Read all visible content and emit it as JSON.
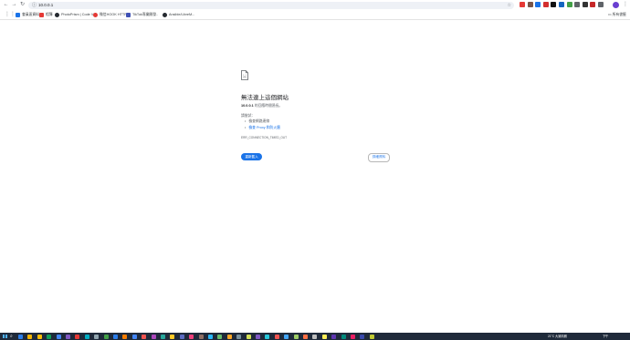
{
  "browser": {
    "url": "10.0.0.1",
    "bookmarks": [
      {
        "label": "會員區資料",
        "color": "#1a73e8"
      },
      {
        "label": "相簿",
        "color": "#e53935"
      },
      {
        "label": "PhotoPrism | Code V...",
        "color": "#24292f"
      },
      {
        "label": "微信HOOK HTTP",
        "color": "#e53935"
      },
      {
        "label": "TikTok專業開發..",
        "color": "#3f51b5"
      },
      {
        "label": "Ansible/LibreM...",
        "color": "#24292f"
      }
    ],
    "bookmarks_folder": "所有書籤",
    "extension_colors": [
      "#e53935",
      "#795548",
      "#1a73e8",
      "#d32f2f",
      "#111111",
      "#1565c0",
      "#43a047",
      "#5f6368",
      "#333333",
      "#c62828",
      "#5f6368"
    ]
  },
  "error_page": {
    "title": "無法連上這個網站",
    "host": "10.0.0.1",
    "message": " 的回應時間過長。",
    "try_heading": "請嘗試：",
    "suggestions": [
      "檢查網路連線",
      "檢查 Proxy 和防火牆"
    ],
    "error_code": "ERR_CONNECTION_TIMED_OUT",
    "reload_button": "重新載入",
    "details_button": "詳細資料"
  },
  "taskbar": {
    "weather": "21°C 大致晴朗",
    "time": "下午",
    "app_colors": [
      "#2b7de9",
      "#f4b400",
      "#fbbc05",
      "#0f9d58",
      "#4285f4",
      "#7e57c2",
      "#e53935",
      "#00acc1",
      "#90a4ae",
      "#43a047",
      "#2b7de9",
      "#f57c00",
      "#4285f4",
      "#ef5350",
      "#ab47bc",
      "#26a69a",
      "#ffca28",
      "#5c6bc0",
      "#ec407a",
      "#8d6e63",
      "#29b6f6",
      "#66bb6a",
      "#ffa726",
      "#78909c",
      "#d4e157",
      "#7e57c2",
      "#26c6da",
      "#ef5350",
      "#42a5f5",
      "#9ccc65",
      "#ff7043",
      "#bdbdbd",
      "#ffee58",
      "#5e35b1",
      "#00897b",
      "#e91e63",
      "#3949ab",
      "#c0ca33"
    ]
  }
}
